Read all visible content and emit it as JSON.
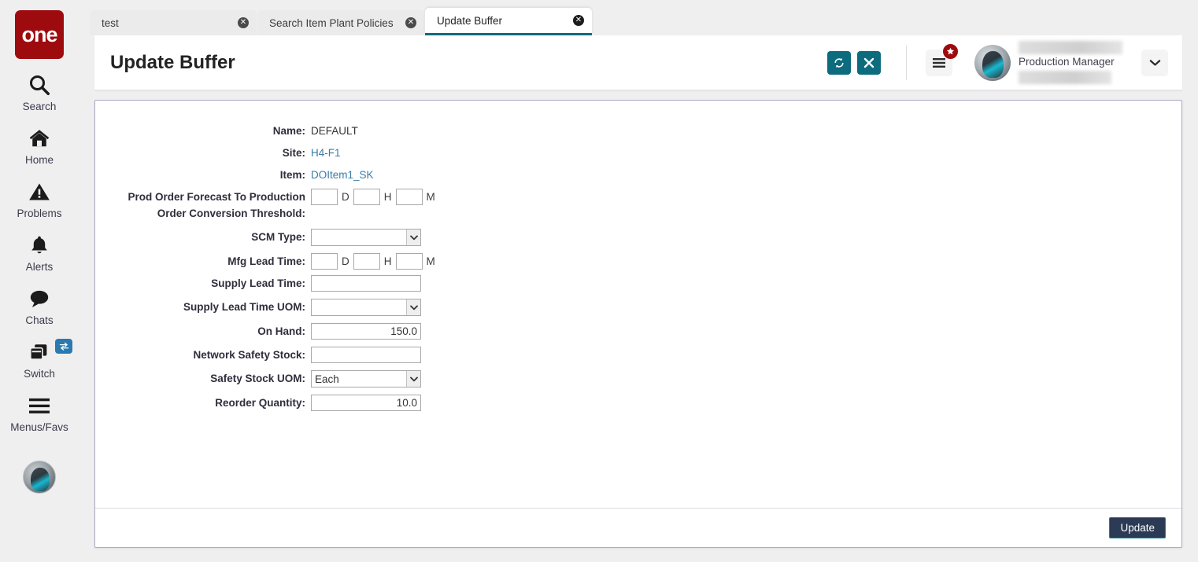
{
  "brand": {
    "logo_text": "one",
    "logo_color": "#9e0b0f"
  },
  "theme": {
    "accent_teal": "#0d6b7e",
    "tab_active_underline": "#0d6b7e",
    "update_btn_bg": "#2b3a55",
    "update_btn_border": "#1a8195",
    "badge_red": "#9e0b0f",
    "switch_badge_blue": "#2a7ab0",
    "link_color": "#3a7ca5"
  },
  "sidebar": {
    "items": [
      {
        "icon": "search-icon",
        "label": "Search"
      },
      {
        "icon": "home-icon",
        "label": "Home"
      },
      {
        "icon": "warning-icon",
        "label": "Problems"
      },
      {
        "icon": "bell-icon",
        "label": "Alerts"
      },
      {
        "icon": "chat-bubble-icon",
        "label": "Chats"
      },
      {
        "icon": "switch-icon",
        "label": "Switch"
      },
      {
        "icon": "hamburger-icon",
        "label": "Menus/Favs"
      }
    ]
  },
  "tabs": [
    {
      "label": "test",
      "active": false,
      "close": "✕"
    },
    {
      "label": "Search Item Plant Policies",
      "active": false,
      "close": "✕"
    },
    {
      "label": "Update Buffer",
      "active": true,
      "close": "✕"
    }
  ],
  "header": {
    "title": "Update Buffer",
    "refresh_label": "⟳",
    "close_label": "✕",
    "menu_badge": "★",
    "user": {
      "role": "Production Manager"
    },
    "caret": "∨"
  },
  "form": {
    "name": {
      "label": "Name:",
      "value": "DEFAULT"
    },
    "site": {
      "label": "Site:",
      "value": "H4-F1"
    },
    "item": {
      "label": "Item:",
      "value": "DOItem1_SK"
    },
    "prod_order_threshold": {
      "label": "Prod Order Forecast To Production Order Conversion Threshold:",
      "days": "",
      "hours": "",
      "minutes": "",
      "unit_d": "D",
      "unit_h": "H",
      "unit_m": "M"
    },
    "scm_type": {
      "label": "SCM Type:",
      "value": ""
    },
    "mfg_lead_time": {
      "label": "Mfg Lead Time:",
      "days": "",
      "hours": "",
      "minutes": "",
      "unit_d": "D",
      "unit_h": "H",
      "unit_m": "M"
    },
    "supply_lead_time": {
      "label": "Supply Lead Time:",
      "value": ""
    },
    "supply_lead_time_uom": {
      "label": "Supply Lead Time UOM:",
      "value": ""
    },
    "on_hand": {
      "label": "On Hand:",
      "value": "150.0"
    },
    "network_safety_stock": {
      "label": "Network Safety Stock:",
      "value": ""
    },
    "safety_stock_uom": {
      "label": "Safety Stock UOM:",
      "value": "Each"
    },
    "reorder_quantity": {
      "label": "Reorder Quantity:",
      "value": "10.0"
    }
  },
  "footer": {
    "update_label": "Update"
  }
}
